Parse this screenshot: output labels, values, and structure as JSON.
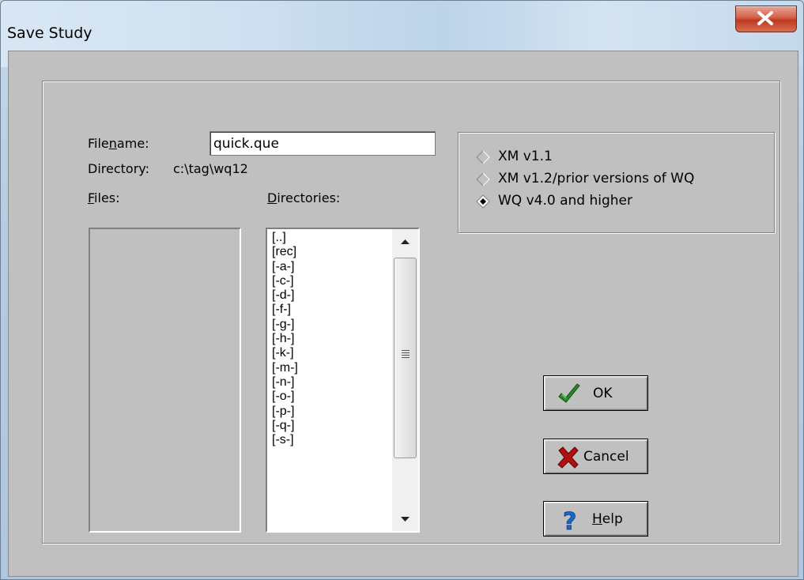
{
  "window": {
    "title": "Save Study"
  },
  "form": {
    "filename_label_pre": "File",
    "filename_label_u": "n",
    "filename_label_post": "ame:",
    "filename_value": "quick.que",
    "directory_label": "Directory:",
    "directory_value": "c:\\tag\\wq12",
    "files_label_u": "F",
    "files_label_post": "iles:",
    "directories_label_u": "D",
    "directories_label_post": "irectories:"
  },
  "directories": [
    "[..]",
    "[rec]",
    "[-a-]",
    "[-c-]",
    "[-d-]",
    "[-f-]",
    "[-g-]",
    "[-h-]",
    "[-k-]",
    "[-m-]",
    "[-n-]",
    "[-o-]",
    "[-p-]",
    "[-q-]",
    "[-s-]"
  ],
  "format_options": [
    {
      "label": "XM v1.1",
      "selected": false
    },
    {
      "label": "XM v1.2/prior versions of WQ",
      "selected": false
    },
    {
      "label": "WQ v4.0 and higher",
      "selected": true
    }
  ],
  "buttons": {
    "ok_label": "OK",
    "cancel_label": "Cancel",
    "help_label_u": "H",
    "help_label_post": "elp"
  },
  "icons": {
    "ok": "checkmark-icon",
    "cancel": "x-cross-icon",
    "help": "question-mark-icon",
    "close": "close-icon"
  },
  "colors": {
    "dialog_bg": "#c0c0c0",
    "close_button": "#c8462c",
    "ok_check": "#2a8a2a",
    "cancel_x": "#b01010",
    "help_q": "#1a66c8"
  }
}
